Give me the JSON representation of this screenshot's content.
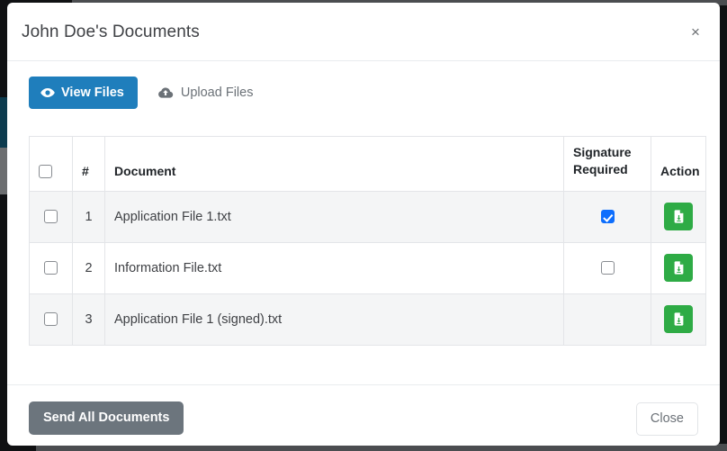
{
  "modal": {
    "title": "John Doe's Documents",
    "close_x_icon": "close-icon",
    "close_x_label": "×"
  },
  "toolbar": {
    "view_files": {
      "label": "View Files",
      "icon": "eye-icon",
      "active": true
    },
    "upload_files": {
      "label": "Upload Files",
      "icon": "cloud-upload-icon",
      "active": false
    }
  },
  "table": {
    "headers": {
      "select_all": "",
      "number": "#",
      "document": "Document",
      "signature_required_line1": "Signature",
      "signature_required_line2": "Required",
      "action": "Action"
    },
    "rows": [
      {
        "selected": false,
        "number": "1",
        "document": "Application File 1.txt",
        "signature_required": true,
        "signature_checkbox_shown": true,
        "action_icon": "file-download-icon"
      },
      {
        "selected": false,
        "number": "2",
        "document": "Information File.txt",
        "signature_required": false,
        "signature_checkbox_shown": true,
        "action_icon": "file-download-icon"
      },
      {
        "selected": false,
        "number": "3",
        "document": "Application File 1 (signed).txt",
        "signature_required": false,
        "signature_checkbox_shown": false,
        "action_icon": "file-download-icon"
      }
    ]
  },
  "footer": {
    "send_all_label": "Send All Documents",
    "close_label": "Close"
  },
  "colors": {
    "primary": "#1f7ebc",
    "success": "#2eab45",
    "secondary": "#6c757d",
    "checkbox_checked": "#0d6efd",
    "row_striped": "#f4f5f6",
    "border": "#e3e5e8"
  }
}
